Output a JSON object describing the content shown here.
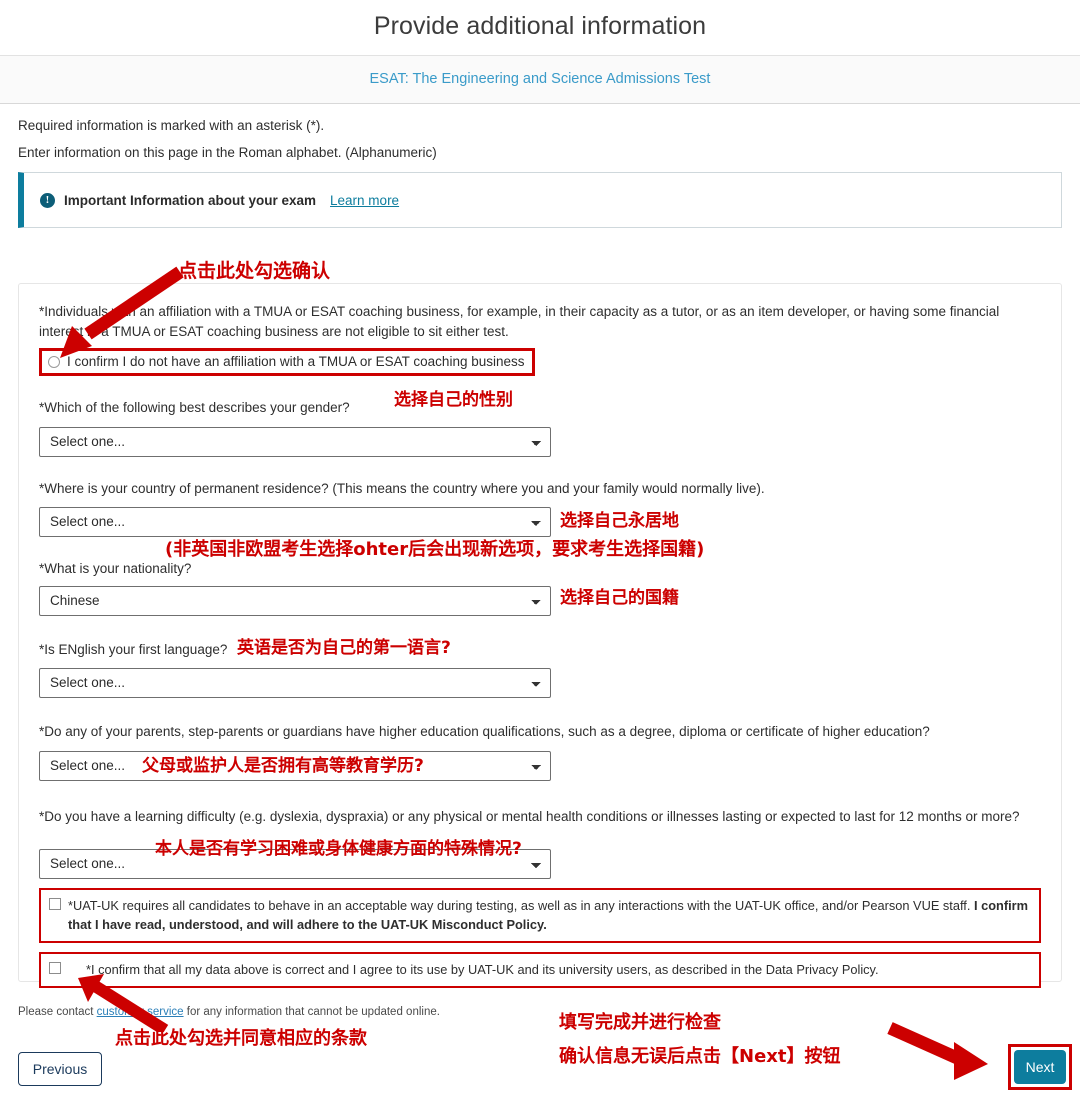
{
  "header": {
    "title": "Provide additional information",
    "exam_name": "ESAT: The Engineering and Science Admissions Test"
  },
  "intro": {
    "required_note": "Required information is marked with an asterisk (*).",
    "alphabet_note": "Enter information on this page in the Roman alphabet. (Alphanumeric)"
  },
  "info_banner": {
    "icon": "info-exclamation-icon",
    "text": "Important Information about your exam",
    "link_label": "Learn more"
  },
  "affiliation": {
    "statement": "*Individuals with an affiliation with a TMUA or ESAT coaching business, for example, in their capacity as a tutor, or as an item developer, or having some financial interest in a TMUA or ESAT coaching business are not eligible to sit either test.",
    "radio_label": "I confirm I do not have an affiliation with a TMUA or ESAT coaching business",
    "radio_checked": false
  },
  "questions": [
    {
      "label": "*Which of the following best describes your gender?",
      "value": "Select one...",
      "name": "gender-select"
    },
    {
      "label": "*Where is your country of permanent residence? (This means the country where you and your family would normally live).",
      "value": "Select one...",
      "name": "residence-select"
    },
    {
      "label": "*What is your nationality?",
      "value": "Chinese",
      "name": "nationality-select"
    },
    {
      "label": "*Is ENglish your first language?",
      "value": "Select one...",
      "name": "first-language-select"
    },
    {
      "label": "*Do any of your parents, step-parents or guardians have higher education qualifications, such as a degree, diploma or certificate of higher education?",
      "value": "Select one...",
      "name": "parents-education-select"
    },
    {
      "label": "*Do you have a learning difficulty (e.g. dyslexia, dyspraxia) or any physical or mental health conditions or illnesses lasting or expected to last for 12 months or more?",
      "value": "Select one...",
      "name": "learning-difficulty-select"
    }
  ],
  "consents": [
    {
      "plain": "*UAT-UK requires all candidates to behave in an acceptable way during testing, as well as in any interactions with the UAT-UK office, and/or Pearson VUE staff. ",
      "bold": "I confirm that I have read, understood, and will adhere to the UAT-UK Misconduct Policy.",
      "checked": false
    },
    {
      "plain": "*I confirm that all my data above is correct and I agree to its use by UAT-UK and its university users, as described in the Data Privacy Policy.",
      "bold": "",
      "checked": false
    }
  ],
  "footer": {
    "note_before": "Please contact ",
    "note_link": "customer service",
    "note_after": " for any information that cannot be updated online.",
    "previous_label": "Previous",
    "next_label": "Next"
  },
  "annotations": {
    "confirm_affiliation": "点击此处勾选确认",
    "gender": "选择自己的性别",
    "residence": "选择自己永居地",
    "residence_note": "(非英国非欧盟考生选择ohter后会出现新选项，要求考生选择国籍)",
    "nationality": "选择自己的国籍",
    "first_language": "英语是否为自己的第一语言?",
    "parents_education": "父母或监护人是否拥有高等教育学历?",
    "learning_difficulty": "本人是否有学习困难或身体健康方面的特殊情况?",
    "consent_click": "点击此处勾选并同意相应的条款",
    "final_line1": "填写完成并进行检查",
    "final_line2": "确认信息无误后点击【Next】按钮"
  },
  "colors": {
    "accent_teal": "#0d7d9e",
    "annotation_red": "#cc0000",
    "exam_link_blue": "#3a9bc9",
    "previous_navy": "#1b3a5c"
  }
}
